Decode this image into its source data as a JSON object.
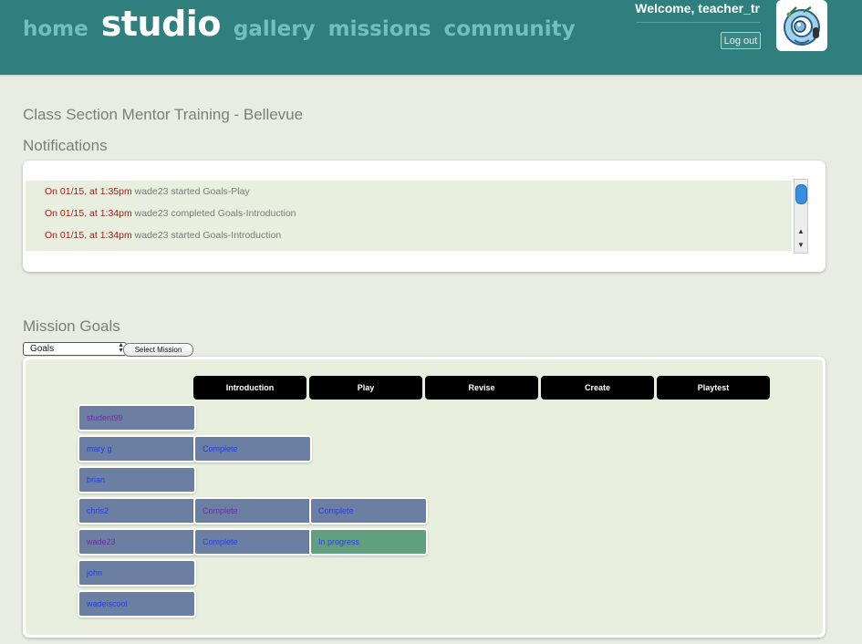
{
  "header": {
    "nav": [
      "home",
      "studio",
      "gallery",
      "missions",
      "community"
    ],
    "active": "studio",
    "welcome": "Welcome, teacher_tr",
    "logout_label": "Log out"
  },
  "page": {
    "class_title": "Class Section Mentor Training - Bellevue",
    "notifications_title": "Notifications",
    "mission_goals_title": "Mission Goals"
  },
  "notifications": [
    {
      "time": "On 01/15, at 1:35pm",
      "text": "wade23 started Goals-Play"
    },
    {
      "time": "On 01/15, at 1:34pm",
      "text": "wade23 completed Goals-Introduction"
    },
    {
      "time": "On 01/15, at 1:34pm",
      "text": "wade23 started Goals-Introduction"
    }
  ],
  "mission_select": {
    "selected": "Goals",
    "button_label": "Select Mission"
  },
  "goals_table": {
    "columns": [
      "Introduction",
      "Play",
      "Revise",
      "Create",
      "Playtest"
    ],
    "students": [
      "student99",
      "mary g",
      "brian",
      "chris2",
      "wade23",
      "john",
      "wadeiscool"
    ],
    "statuses": {
      "mary g": [
        "Complete"
      ],
      "chris2": [
        "Complete",
        "Complete"
      ],
      "wade23": [
        "Complete",
        "In progress"
      ]
    }
  },
  "colors": {
    "header_bg": "#2e7f7d",
    "cell_bg": "#6a7fa2",
    "in_progress_bg": "#61a07e",
    "timestamp": "#9b1b1b"
  }
}
